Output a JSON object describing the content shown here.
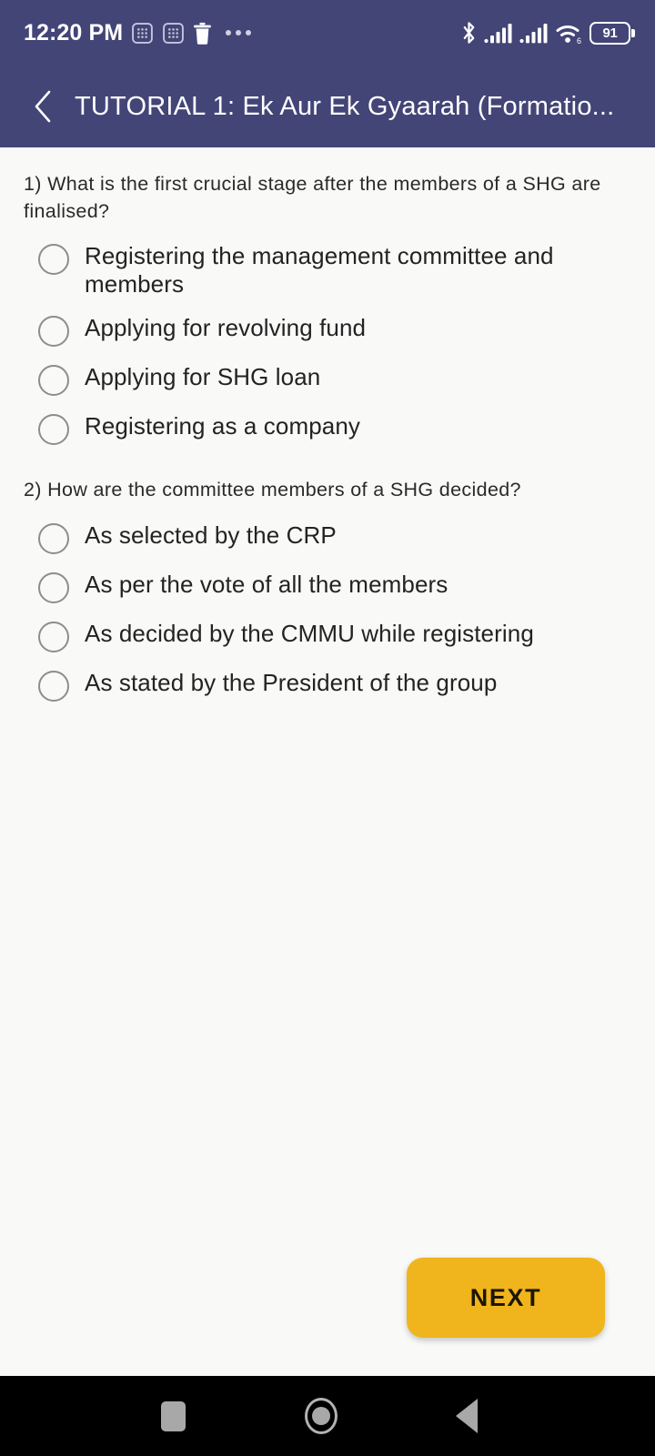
{
  "statusbar": {
    "time": "12:20 PM",
    "battery_level": "91",
    "wifi_generation": "6",
    "icons": [
      "keyboard-icon",
      "keyboard-icon",
      "trash-icon",
      "overflow-dots-icon",
      "bluetooth-icon",
      "signal-sim1-icon",
      "signal-sim2-icon",
      "wifi-icon",
      "battery-icon"
    ]
  },
  "appbar": {
    "back_icon": "chevron-left-icon",
    "title": "TUTORIAL 1: Ek Aur Ek Gyaarah (Formatio..."
  },
  "quiz": {
    "questions": [
      {
        "number": "1)",
        "text": "1) What is the first crucial stage after the members of a SHG are finalised?",
        "options": [
          "Registering the management committee and members",
          "Applying for revolving fund",
          "Applying for SHG loan",
          "Registering as a company"
        ]
      },
      {
        "number": "2)",
        "text": "2) How are the committee members of a SHG decided?",
        "options": [
          "As selected by the CRP",
          "As per the vote of all the members",
          "As decided by the CMMU while registering",
          "As stated by the President of the group"
        ]
      }
    ]
  },
  "footer": {
    "next_label": "NEXT"
  },
  "navbar": {
    "recents_icon": "square-recents-icon",
    "home_icon": "circle-home-icon",
    "back_icon": "triangle-back-icon"
  },
  "colors": {
    "appbar": "#434577",
    "accent": "#f0b51c",
    "background": "#f9f9f8",
    "navbar": "#000000"
  }
}
